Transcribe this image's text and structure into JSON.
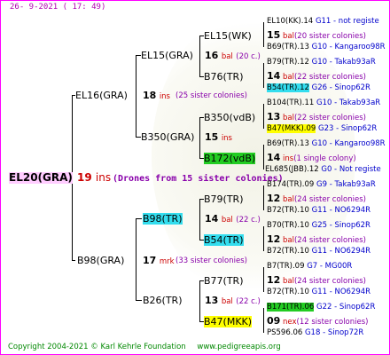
{
  "date": "26-  9-2021  ( 17:  49)",
  "root": {
    "name": "EL20(GRA)",
    "number": "19",
    "unit": "ins",
    "note": "(Drones from 15 sister colonies)"
  },
  "gen1": [
    {
      "name": "EL16(GRA)",
      "number": "18",
      "unit": "ins",
      "note": "(25 sister colonies)"
    },
    {
      "name": "B98(GRA)",
      "number": "17",
      "unit": "mrk",
      "note": "(33 sister colonies)"
    }
  ],
  "gen2": [
    {
      "name": "EL15(GRA)",
      "number": "16",
      "unit": "bal",
      "note": "(20 c.)"
    },
    {
      "name": "B350(GRA)",
      "number": "15",
      "unit": "ins",
      "note": ""
    },
    {
      "name": "B98(TR)",
      "number": "14",
      "unit": "bal",
      "note": "(22 c.)"
    },
    {
      "name": "B26(TR)",
      "number": "13",
      "unit": "bal",
      "note": "(22 c.)"
    }
  ],
  "gen3": [
    {
      "name": "EL15(WK)",
      "number": "15",
      "unit": "bal",
      "note": "(20 sister colonies)"
    },
    {
      "name": "B76(TR)",
      "number": "14",
      "unit": "bal",
      "note": "(22 sister colonies)"
    },
    {
      "name": "B350(vdB)",
      "number": "13",
      "unit": "bal",
      "note": "(22 sister colonies)"
    },
    {
      "name": "B172(vdB)",
      "number": "14",
      "unit": "ins",
      "note": "(1 single colony)"
    },
    {
      "name": "B79(TR)",
      "number": "12",
      "unit": "bal",
      "note": "(24 sister colonies)"
    },
    {
      "name": "B54(TR)",
      "number": "12",
      "unit": "bal",
      "note": "(24 sister colonies)"
    },
    {
      "name": "B77(TR)",
      "number": "12",
      "unit": "bal",
      "note": "(24 sister colonies)"
    },
    {
      "name": "B47(MKK)",
      "number": "09",
      "unit": "nex",
      "note": "(12 sister colonies)"
    }
  ],
  "gen4": [
    {
      "name": "EL10(KK).14",
      "breeder": "G11 - not registe"
    },
    {
      "name": "B69(TR).13",
      "breeder": "G10 - Kangaroo98R"
    },
    {
      "name": "B79(TR).12",
      "breeder": "G10 - Takab93aR"
    },
    {
      "name": "B54(TR).12",
      "breeder": "G26 - Sinop62R"
    },
    {
      "name": "B104(TR).11",
      "breeder": "G10 - Takab93aR"
    },
    {
      "name": "B47(MKK).09",
      "breeder": "G23 - Sinop62R"
    },
    {
      "name": "B69(TR).13",
      "breeder": "G10 - Kangaroo98R"
    },
    {
      "name": "EL685(JBB).12",
      "breeder": "G0 - Not registe"
    },
    {
      "name": "B174(TR).09",
      "breeder": "G9 - Takab93aR"
    },
    {
      "name": "B72(TR).10",
      "breeder": "G11 - NO6294R"
    },
    {
      "name": "B70(TR).10",
      "breeder": "G25 - Sinop62R"
    },
    {
      "name": "B72(TR).10",
      "breeder": "G11 - NO6294R"
    },
    {
      "name": "B7(TR).09",
      "breeder": "G7 - MG00R"
    },
    {
      "name": "B72(TR).10",
      "breeder": "G11 - NO6294R"
    },
    {
      "name": "B171(TR).06",
      "breeder": "G22 - Sinop62R"
    },
    {
      "name": "PS596.06",
      "breeder": "G18 - Sinop72R"
    }
  ],
  "footer": {
    "copyright": "Copyright 2004-2021 © Karl Kehrle Foundation",
    "site": "www.pedigreeapis.org"
  }
}
